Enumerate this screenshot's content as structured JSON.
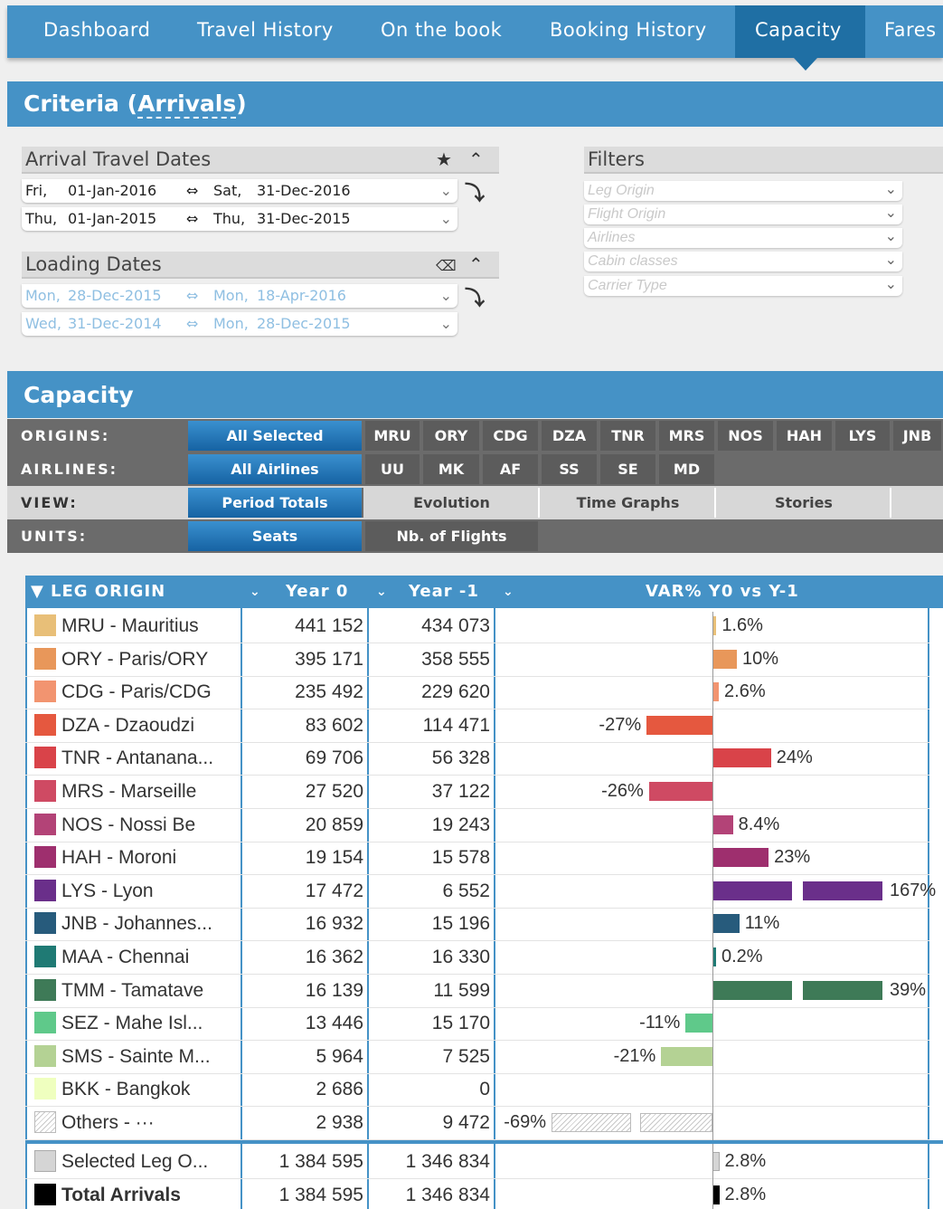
{
  "nav": {
    "tabs": [
      {
        "label": "Dashboard",
        "active": false
      },
      {
        "label": "Travel History",
        "active": false
      },
      {
        "label": "On the book",
        "active": false
      },
      {
        "label": "Booking History",
        "active": false
      },
      {
        "label": "Capacity",
        "active": true
      },
      {
        "label": "Fares",
        "active": false
      }
    ]
  },
  "criteria": {
    "title_prefix": "Criteria (",
    "title_link": "Arrivals",
    "title_suffix": ")",
    "arrival": {
      "heading": "Arrival Travel Dates",
      "ranges": [
        {
          "from_day": "Fri,",
          "from_date": "01-Jan-2016",
          "to_day": "Sat,",
          "to_date": "31-Dec-2016"
        },
        {
          "from_day": "Thu,",
          "from_date": "01-Jan-2015",
          "to_day": "Thu,",
          "to_date": "31-Dec-2015"
        }
      ]
    },
    "loading": {
      "heading": "Loading Dates",
      "ranges": [
        {
          "from_day": "Mon,",
          "from_date": "28-Dec-2015",
          "to_day": "Mon,",
          "to_date": "18-Apr-2016"
        },
        {
          "from_day": "Wed,",
          "from_date": "31-Dec-2014",
          "to_day": "Mon,",
          "to_date": "28-Dec-2015"
        }
      ]
    },
    "filters": {
      "heading": "Filters",
      "placeholders": [
        "Leg Origin",
        "Flight Origin",
        "Airlines",
        "Cabin classes",
        "Carrier Type"
      ]
    }
  },
  "capacity": {
    "title": "Capacity",
    "origins": {
      "label": "ORIGINS:",
      "selected": "All Selected",
      "items": [
        "MRU",
        "ORY",
        "CDG",
        "DZA",
        "TNR",
        "MRS",
        "NOS",
        "HAH",
        "LYS",
        "JNB"
      ]
    },
    "airlines": {
      "label": "AIRLINES:",
      "selected": "All Airlines",
      "items": [
        "UU",
        "MK",
        "AF",
        "SS",
        "SE",
        "MD"
      ]
    },
    "view": {
      "label": "VIEW:",
      "selected": "Period Totals",
      "items": [
        "Evolution",
        "Time Graphs",
        "Stories"
      ]
    },
    "units": {
      "label": "UNITS:",
      "selected": "Seats",
      "items": [
        "Nb. of Flights"
      ]
    }
  },
  "table": {
    "headers": {
      "leg": "LEG ORIGIN",
      "y0": "Year 0",
      "y1": "Year -1",
      "var": "VAR% Y0 vs Y-1"
    },
    "rows": [
      {
        "name": "MRU - Mauritius",
        "y0": "441 152",
        "y1": "434 073",
        "pct": "1.6%",
        "var": 1.6,
        "color": "#e8bf78"
      },
      {
        "name": "ORY - Paris/ORY",
        "y0": "395 171",
        "y1": "358 555",
        "pct": "10%",
        "var": 10,
        "color": "#e8975a"
      },
      {
        "name": "CDG - Paris/CDG",
        "y0": "235 492",
        "y1": "229 620",
        "pct": "2.6%",
        "var": 2.6,
        "color": "#f29470"
      },
      {
        "name": "DZA - Dzaoudzi",
        "y0": "83 602",
        "y1": "114 471",
        "pct": "-27%",
        "var": -27,
        "color": "#e5583f"
      },
      {
        "name": "TNR - Antanana...",
        "y0": "69 706",
        "y1": "56 328",
        "pct": "24%",
        "var": 24,
        "color": "#d94349"
      },
      {
        "name": "MRS - Marseille",
        "y0": "27 520",
        "y1": "37 122",
        "pct": "-26%",
        "var": -26,
        "color": "#cf4a63"
      },
      {
        "name": "NOS - Nossi Be",
        "y0": "20 859",
        "y1": "19 243",
        "pct": "8.4%",
        "var": 8.4,
        "color": "#b34377"
      },
      {
        "name": "HAH - Moroni",
        "y0": "19 154",
        "y1": "15 578",
        "pct": "23%",
        "var": 23,
        "color": "#9e2f6e"
      },
      {
        "name": "LYS - Lyon",
        "y0": "17 472",
        "y1": "6 552",
        "pct": "167%",
        "var": 167,
        "color": "#6a2f8a"
      },
      {
        "name": "JNB - Johannes...",
        "y0": "16 932",
        "y1": "15 196",
        "pct": "11%",
        "var": 11,
        "color": "#275b7c"
      },
      {
        "name": "MAA - Chennai",
        "y0": "16 362",
        "y1": "16 330",
        "pct": "0.2%",
        "var": 0.2,
        "color": "#1f7a74"
      },
      {
        "name": "TMM - Tamatave",
        "y0": "16 139",
        "y1": "11 599",
        "pct": "39%",
        "var": 39,
        "color": "#3e7a57"
      },
      {
        "name": "SEZ - Mahe Isl...",
        "y0": "13 446",
        "y1": "15 170",
        "pct": "-11%",
        "var": -11,
        "color": "#5fc98a"
      },
      {
        "name": "SMS - Sainte M...",
        "y0": "5 964",
        "y1": "7 525",
        "pct": "-21%",
        "var": -21,
        "color": "#b4d294"
      },
      {
        "name": "BKK - Bangkok",
        "y0": "2 686",
        "y1": "0",
        "pct": "",
        "var": 0,
        "color": "#efffbf"
      },
      {
        "name": "Others - ···",
        "y0": "2 938",
        "y1": "9 472",
        "pct": "-69%",
        "var": -69,
        "color": "hatch"
      }
    ],
    "totals": [
      {
        "name": "Selected Leg O...",
        "y0": "1 384 595",
        "y1": "1 346 834",
        "pct": "2.8%",
        "var": 2.8,
        "color": "#d5d5d5",
        "bold": false
      },
      {
        "name": "Total Arrivals",
        "y0": "1 384 595",
        "y1": "1 346 834",
        "pct": "2.8%",
        "var": 2.8,
        "color": "#000000",
        "bold": true
      }
    ]
  }
}
